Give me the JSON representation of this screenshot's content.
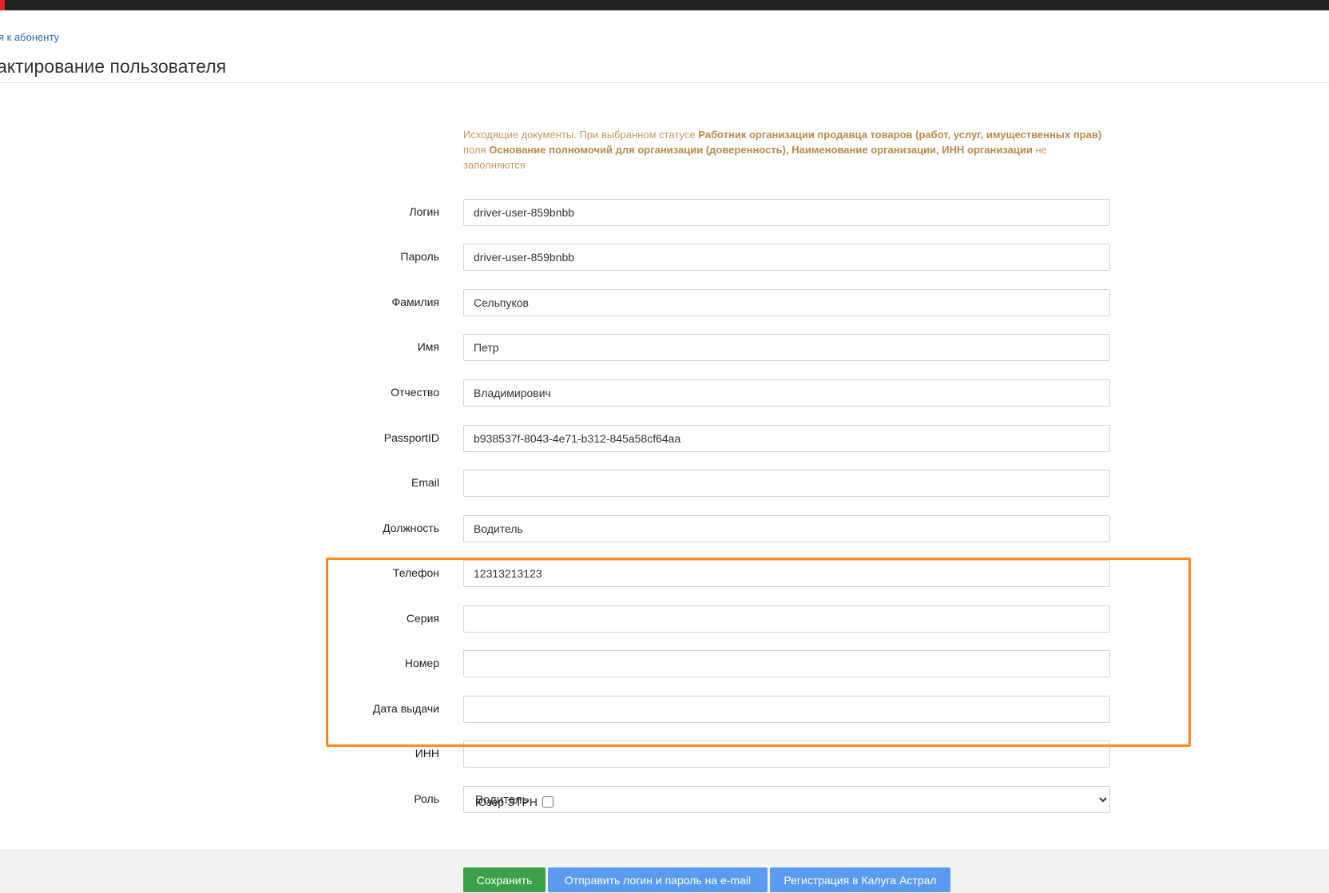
{
  "nav": {
    "back_link": "я к абоненту"
  },
  "page": {
    "title": "актирование пользователя"
  },
  "info": {
    "t1": "Исходящие документы. При выбранном статусе ",
    "b1": "Работник организации продавца товаров (работ, услуг, имущественных прав)",
    "t2": " поля ",
    "b2": "Основание полномочий для организации (доверенность), Наименование организации, ИНН организации",
    "t3": " не заполняются"
  },
  "fields": {
    "login": {
      "label": "Логин",
      "value": "driver-user-859bnbb"
    },
    "password": {
      "label": "Пароль",
      "value": "driver-user-859bnbb"
    },
    "last_name": {
      "label": "Фамилия",
      "value": "Сельпуков"
    },
    "first_name": {
      "label": "Имя",
      "value": "Петр"
    },
    "patronymic": {
      "label": "Отчество",
      "value": "Владимирович"
    },
    "passport_id": {
      "label": "PassportID",
      "value": "b938537f-8043-4e71-b312-845a58cf64aa"
    },
    "email": {
      "label": "Email",
      "value": ""
    },
    "position": {
      "label": "Должность",
      "value": "Водитель"
    },
    "phone": {
      "label": "Телефон",
      "value": "12313213123"
    },
    "series": {
      "label": "Серия",
      "value": ""
    },
    "number": {
      "label": "Номер",
      "value": ""
    },
    "issue_date": {
      "label": "Дата выдачи",
      "value": ""
    },
    "inn": {
      "label": "ИНН",
      "value": ""
    },
    "role": {
      "label": "Роль",
      "selected": "Водитель"
    }
  },
  "etrn": {
    "label": "Юзер ЭТРН",
    "checked": false
  },
  "buttons": {
    "save": "Сохранить",
    "send_credentials": "Отправить логин и пароль на e-mail",
    "register_astral": "Регистрация в Калуга Астрал"
  },
  "colors": {
    "highlight": "#ff8a1e",
    "save_button": "#3aa14a",
    "primary_button": "#5a9bf0",
    "info_text": "#c49a5c"
  }
}
